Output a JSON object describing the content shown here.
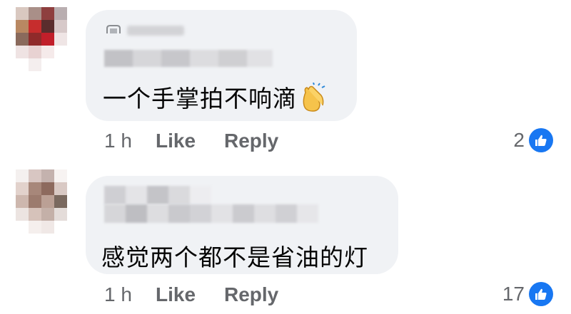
{
  "comments": [
    {
      "text": "一个手掌拍不响滴",
      "emoji_icon": "clapping-hands-icon",
      "time": "1 h",
      "like_label": "Like",
      "reply_label": "Reply",
      "reaction_count": "2",
      "reaction_icon": "thumbs-up-icon"
    },
    {
      "text": "感觉两个都不是省油的灯",
      "time": "1 h",
      "like_label": "Like",
      "reply_label": "Reply",
      "reaction_count": "17",
      "reaction_icon": "thumbs-up-icon"
    }
  ],
  "colors": {
    "bubble": "#f0f2f5",
    "action_text": "#65676b",
    "like_badge": "#1877f2"
  }
}
